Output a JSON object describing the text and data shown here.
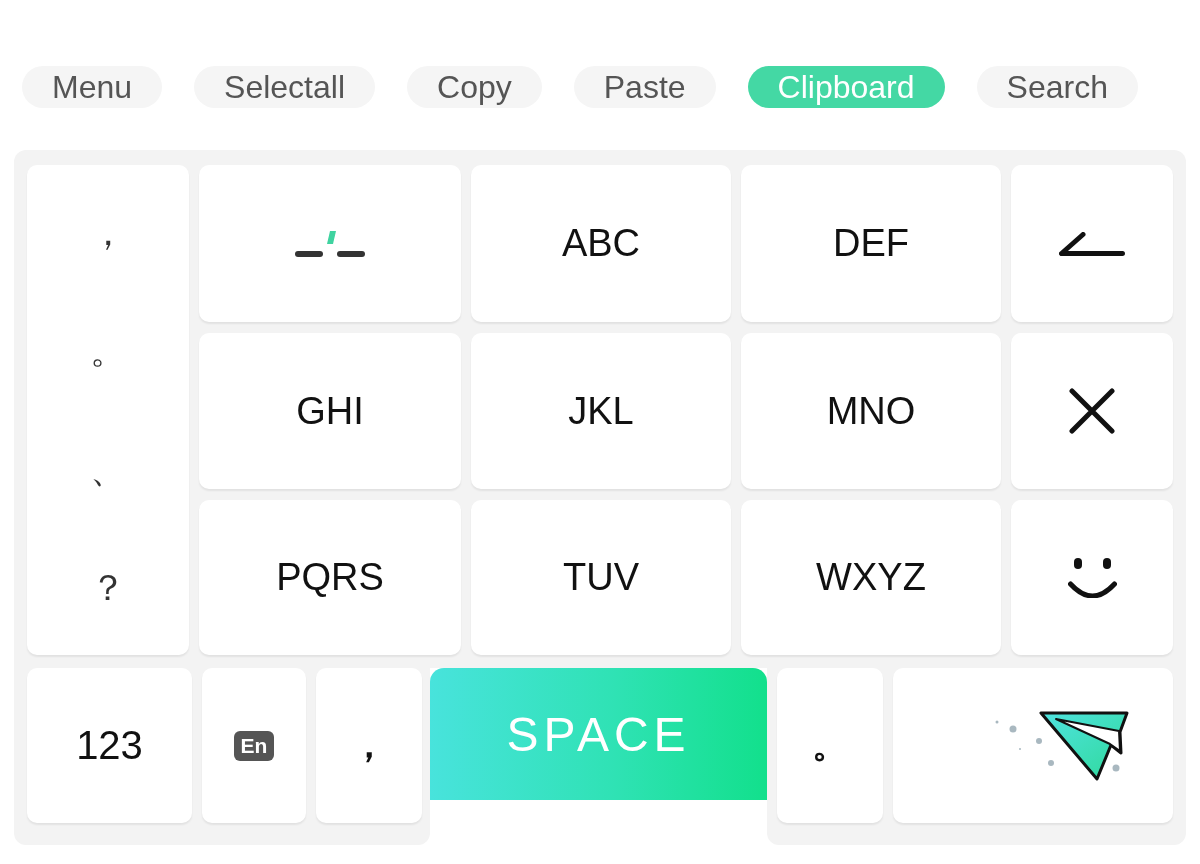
{
  "toolbar": [
    {
      "label": "Menu",
      "selected": false
    },
    {
      "label": "Selectall",
      "selected": false
    },
    {
      "label": "Copy",
      "selected": false
    },
    {
      "label": "Paste",
      "selected": false
    },
    {
      "label": "Clipboard",
      "selected": true
    },
    {
      "label": "Search",
      "selected": false
    }
  ],
  "keyboard": {
    "punctuation_column": [
      "，",
      "。",
      "、",
      "？"
    ],
    "rows": [
      [
        {
          "kind": "separator"
        },
        {
          "kind": "letters",
          "label": "ABC"
        },
        {
          "kind": "letters",
          "label": "DEF"
        },
        {
          "kind": "backspace"
        }
      ],
      [
        {
          "kind": "letters",
          "label": "GHI"
        },
        {
          "kind": "letters",
          "label": "JKL"
        },
        {
          "kind": "letters",
          "label": "MNO"
        },
        {
          "kind": "clear"
        }
      ],
      [
        {
          "kind": "letters",
          "label": "PQRS"
        },
        {
          "kind": "letters",
          "label": "TUV"
        },
        {
          "kind": "letters",
          "label": "WXYZ"
        },
        {
          "kind": "emoji"
        }
      ]
    ],
    "bottom_row": [
      {
        "kind": "numbers",
        "label": "123"
      },
      {
        "kind": "language",
        "label": "En"
      },
      {
        "kind": "punctuation",
        "label": "，"
      },
      {
        "kind": "space",
        "label": "SPACE"
      },
      {
        "kind": "punctuation",
        "label": "。"
      },
      {
        "kind": "send"
      }
    ]
  }
}
